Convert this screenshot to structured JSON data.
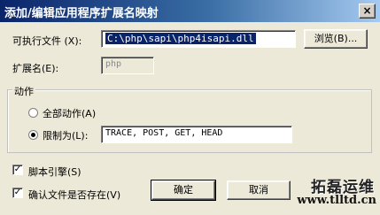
{
  "window": {
    "title": "添加/编辑应用程序扩展名映射",
    "close_glyph": "×"
  },
  "executable": {
    "label": "可执行文件 (X):",
    "value": "C:\\php\\sapi\\php4isapi.dll",
    "browse_label": "浏览(B)..."
  },
  "extension": {
    "label": "扩展名(E):",
    "value": "php"
  },
  "verbs": {
    "group_title": "动作",
    "all_label": "全部动作(A)",
    "all_selected": false,
    "limit_label": "限制为(L):",
    "limit_selected": true,
    "limit_value": "TRACE, POST, GET, HEAD"
  },
  "options": {
    "script_engine_label": "脚本引擎(S)",
    "script_engine_checked": true,
    "verify_file_label": "确认文件是否存在(V)",
    "verify_file_checked": true,
    "check_glyph": "✓"
  },
  "buttons": {
    "ok_label": "确定",
    "cancel_label": "取消"
  },
  "watermark": {
    "brand": "拓磊运维",
    "url": "www.tlltd.cn"
  }
}
